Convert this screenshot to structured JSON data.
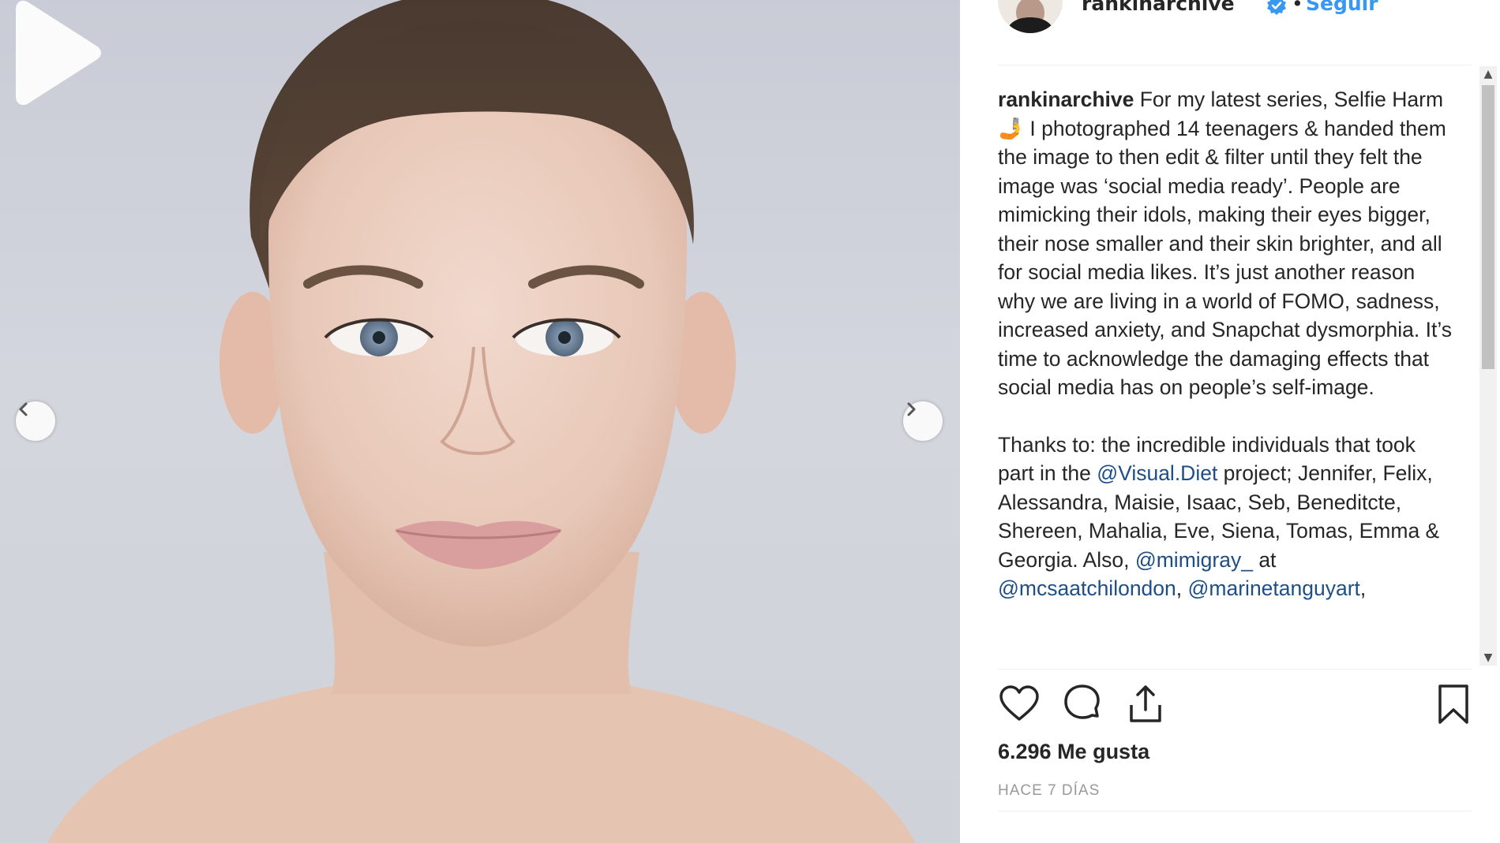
{
  "media": {
    "prev_icon": "chevron-left-icon",
    "next_icon": "chevron-right-icon",
    "play_icon": "play-icon"
  },
  "post": {
    "username": "rankinarchive",
    "separator": "•",
    "follow_label": "Seguir",
    "verified_icon": "verified-badge-icon",
    "caption": {
      "p1_before": "For my latest series, Selfie Harm ",
      "p1_emoji": "🤳",
      "p1_after": " I photographed 14 teenagers & handed them the image to then edit & filter until they felt the image was ‘social media ready’. People are mimicking their idols, making their eyes bigger, their nose smaller and their skin brighter, and all for social media likes. It’s just another reason why we are living in a world of FOMO, sadness, increased anxiety, and Snapchat dysmorphia. It’s time to acknowledge the damaging effects that social media has on people’s self-image.",
      "p2_a": "Thanks to: the incredible individuals that took part in the ",
      "mention_1": "@Visual.Diet",
      "p2_b": " project; Jennifer, Felix, Alessandra, Maisie, Isaac, Seb, Beneditcte, Shereen, Mahalia, Eve, Siena, Tomas, Emma & Georgia. Also, ",
      "mention_2": "@mimigray_",
      "p2_c": " at ",
      "mention_3": "@mcsaatchilondon",
      "p2_d": ", ",
      "mention_4": "@marinetanguyart",
      "p2_e": ","
    },
    "likes": "6.296 Me gusta",
    "timestamp": "HACE 7 DÍAS"
  },
  "actions": {
    "like_icon": "heart-icon",
    "comment_icon": "comment-icon",
    "share_icon": "share-icon",
    "save_icon": "bookmark-icon"
  },
  "colors": {
    "link": "#3897f0",
    "mention": "#1d4f86",
    "text": "#262626",
    "muted": "#999999"
  }
}
